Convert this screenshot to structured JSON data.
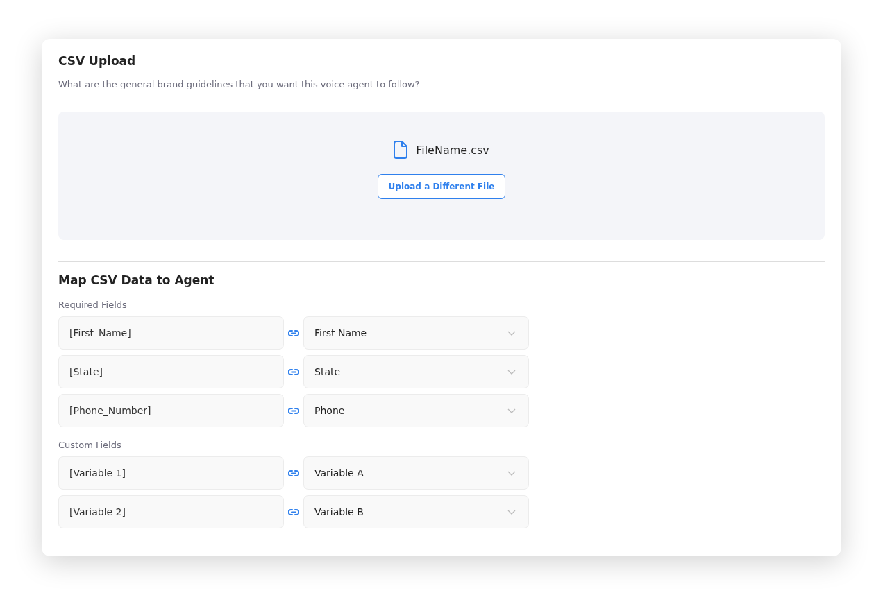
{
  "upload": {
    "title": "CSV Upload",
    "description": "What are the general brand guidelines that you want this voice agent to follow?",
    "file_name": "FileName.csv",
    "button": "Upload a Different File"
  },
  "mapping": {
    "title": "Map CSV Data to Agent",
    "groups": [
      {
        "label": "Required Fields",
        "rows": [
          {
            "source": "[First_Name]",
            "target": "First Name"
          },
          {
            "source": "[State]",
            "target": "State"
          },
          {
            "source": "[Phone_Number]",
            "target": "Phone"
          }
        ]
      },
      {
        "label": "Custom Fields",
        "rows": [
          {
            "source": "[Variable 1]",
            "target": "Variable A"
          },
          {
            "source": "[Variable 2]",
            "target": "Variable B"
          }
        ]
      }
    ]
  }
}
